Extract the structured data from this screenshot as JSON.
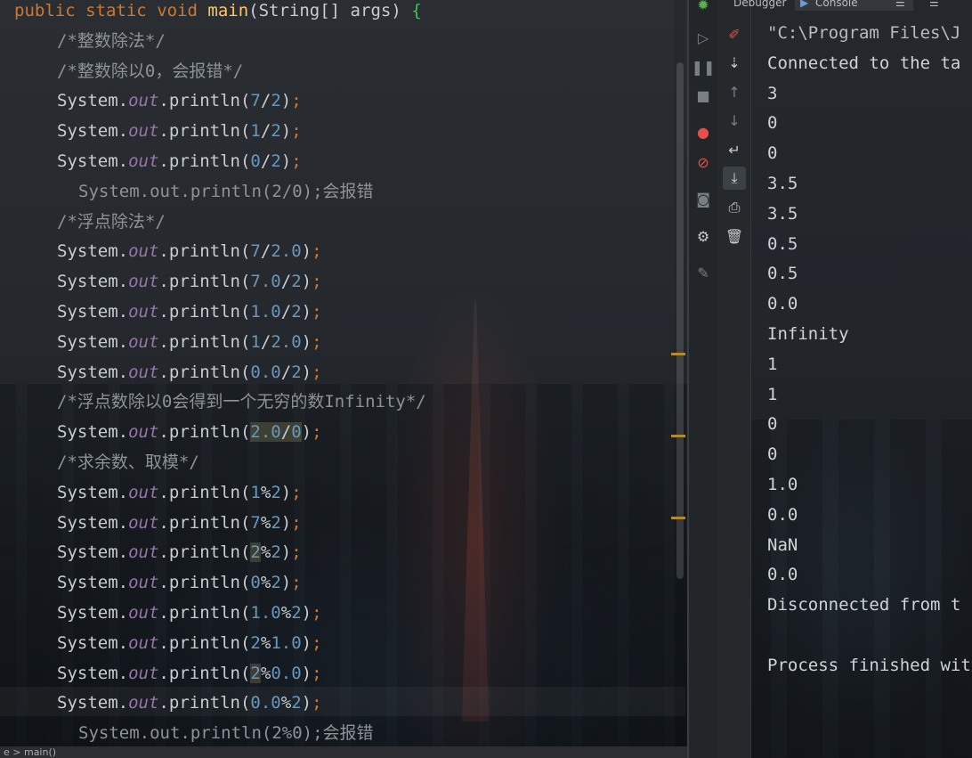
{
  "editor": {
    "method_signature": {
      "kw_public": "public",
      "kw_static": "static",
      "kw_void": "void",
      "name": "main",
      "params": "(String[] args)",
      "brace": "{"
    },
    "lines": [
      {
        "type": "comment",
        "text": "/*整数除法*/"
      },
      {
        "type": "comment",
        "text": "/*整数除以0，会报错*/"
      },
      {
        "type": "print",
        "expr": "7/2"
      },
      {
        "type": "print",
        "expr": "1/2"
      },
      {
        "type": "print",
        "expr": "0/2"
      },
      {
        "type": "disabled",
        "text": "System.out.println(2/0);会报错"
      },
      {
        "type": "comment",
        "text": "/*浮点除法*/"
      },
      {
        "type": "print",
        "expr": "7/2.0"
      },
      {
        "type": "print",
        "expr": "7.0/2"
      },
      {
        "type": "print",
        "expr": "1.0/2"
      },
      {
        "type": "print",
        "expr": "1/2.0"
      },
      {
        "type": "print",
        "expr": "0.0/2"
      },
      {
        "type": "comment",
        "text": "/*浮点数除以0会得到一个无穷的数Infinity*/"
      },
      {
        "type": "print",
        "expr": "2.0/0"
      },
      {
        "type": "comment",
        "text": "/*求余数、取模*/"
      },
      {
        "type": "print",
        "expr": "1%2"
      },
      {
        "type": "print",
        "expr": "7%2"
      },
      {
        "type": "print",
        "expr": "2%2"
      },
      {
        "type": "print",
        "expr": "0%2"
      },
      {
        "type": "print",
        "expr": "1.0%2"
      },
      {
        "type": "print",
        "expr": "2%1.0"
      },
      {
        "type": "print",
        "expr": "2%0.0"
      },
      {
        "type": "print",
        "expr": "0.0%2"
      },
      {
        "type": "disabled",
        "text": "System.out.println(2%0);会报错"
      }
    ],
    "tokens": {
      "class": "System",
      "dot": ".",
      "field": "out",
      "method": "println",
      "open": "(",
      "close": ")",
      "semi": ";"
    },
    "status_breadcrumb": "e  >  main()"
  },
  "toolbar": {
    "column1": [
      {
        "icon": "bug-icon"
      },
      {
        "icon": "resume-icon"
      },
      {
        "icon": "pause-icon"
      },
      {
        "icon": "stop-icon"
      },
      {
        "icon": "view-breakpoints-icon"
      },
      {
        "icon": "mute-breakpoints-icon"
      },
      {
        "icon": "camera-icon"
      },
      {
        "icon": "settings-icon"
      },
      {
        "icon": "pin-icon"
      }
    ],
    "column2": [
      {
        "icon": "clear-all-icon"
      },
      {
        "icon": "sort-icon"
      },
      {
        "icon": "up-arrow-icon"
      },
      {
        "icon": "down-arrow-icon"
      },
      {
        "icon": "soft-wrap-icon"
      },
      {
        "icon": "scroll-to-end-icon"
      },
      {
        "icon": "print-icon"
      },
      {
        "icon": "trash-icon"
      }
    ]
  },
  "console": {
    "tabs": [
      {
        "label": "Debugger"
      },
      {
        "label": "Console"
      }
    ],
    "output": [
      "\"C:\\Program Files\\J",
      "Connected to the ta",
      "3",
      "0",
      "0",
      "3.5",
      "3.5",
      "0.5",
      "0.5",
      "0.0",
      "Infinity",
      "1",
      "1",
      "0",
      "0",
      "1.0",
      "0.0",
      "NaN",
      "0.0",
      "Disconnected from t",
      "",
      "Process finished wit"
    ]
  },
  "colors": {
    "keyword": "#cc7832",
    "method_name": "#ffc66d",
    "field": "#9876aa",
    "number": "#6897bb",
    "comment": "#8c9297",
    "brace": "#46c05a"
  }
}
